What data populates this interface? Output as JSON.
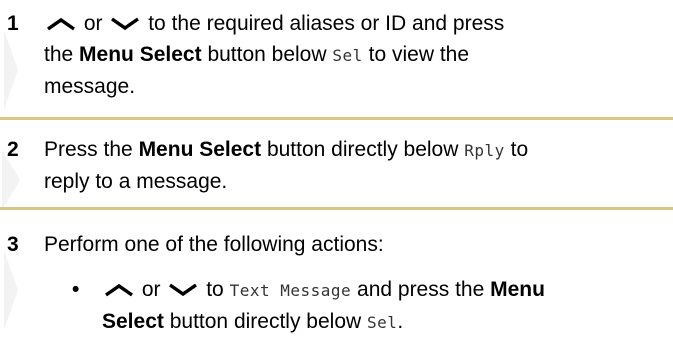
{
  "steps": [
    {
      "number": "1",
      "t_or": "or",
      "t_after_arrows": "to the required aliases or ID and press",
      "t_the": "the",
      "bold_menu_select": "Menu Select",
      "t_button_below": "button below",
      "mono_sel": "Sel",
      "t_to_view": "to view the",
      "t_message": "message."
    },
    {
      "number": "2",
      "t_press_the": "Press the",
      "bold_menu_select": "Menu Select",
      "t_button_directly": "button directly below",
      "mono_rply": "Rply",
      "t_to": "to",
      "t_reply": "reply to a message."
    },
    {
      "number": "3",
      "t_perform": "Perform one of the following actions:"
    }
  ],
  "bullet": {
    "marker": "•",
    "t_or": "or",
    "t_to": "to",
    "mono_text_message": "Text Message",
    "t_and_press_the": "and press the",
    "bold_menu": "Menu",
    "bold_select": "Select",
    "t_button_directly_below": "button directly below",
    "mono_sel": "Sel",
    "t_period": "."
  },
  "icons": {
    "up": "chevron-up-icon",
    "down": "chevron-down-icon"
  },
  "colors": {
    "separator": "#dcc488",
    "mono_text": "#333333"
  }
}
